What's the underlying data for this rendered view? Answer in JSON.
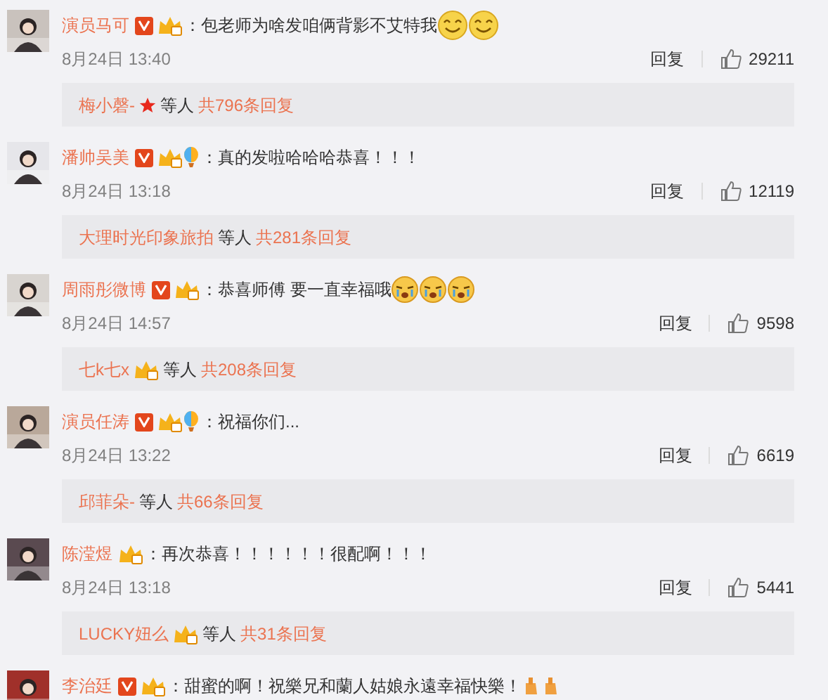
{
  "comments": [
    {
      "name": "演员马可",
      "verified": true,
      "badges": [
        {
          "kind": "vip"
        }
      ],
      "text": "：包老师为啥发咱俩背影不艾特我",
      "emojis": [
        {
          "kind": "smile"
        },
        {
          "kind": "smile"
        }
      ],
      "date": "8月24日 13:40",
      "reply": "回复",
      "likes": "29211",
      "preview": {
        "name": "梅小磬-",
        "badge": {
          "kind": "star"
        },
        "middle": "等人",
        "count": "共796条回复"
      }
    },
    {
      "name": "潘帅吴美",
      "verified": true,
      "badges": [
        {
          "kind": "vip"
        },
        {
          "kind": "balloon"
        }
      ],
      "text": "：真的发啦哈哈哈恭喜！！！",
      "date": "8月24日 13:18",
      "reply": "回复",
      "likes": "12119",
      "preview": {
        "name": "大理时光印象旅拍",
        "middle": "等人",
        "count": "共281条回复"
      }
    },
    {
      "name": "周雨彤微博",
      "verified": true,
      "badges": [
        {
          "kind": "vip"
        }
      ],
      "text": "：恭喜师傅 要一直幸福哦",
      "emojis": [
        {
          "kind": "cry"
        },
        {
          "kind": "cry"
        },
        {
          "kind": "cry"
        }
      ],
      "date": "8月24日 14:57",
      "reply": "回复",
      "likes": "9598",
      "preview": {
        "name": "七k七x",
        "badge": {
          "kind": "vip"
        },
        "middle": "等人",
        "count": "共208条回复"
      }
    },
    {
      "name": "演员任涛",
      "verified": true,
      "badges": [
        {
          "kind": "vip"
        },
        {
          "kind": "balloon"
        }
      ],
      "text": "：祝福你们...",
      "date": "8月24日 13:22",
      "reply": "回复",
      "likes": "6619",
      "preview": {
        "name": "邱菲朵-",
        "middle": "等人",
        "count": "共66条回复"
      }
    },
    {
      "name": "陈滢煜",
      "verified": false,
      "badges": [
        {
          "kind": "vip"
        }
      ],
      "text": "：再次恭喜！！！！！！很配啊！！！",
      "date": "8月24日 13:18",
      "reply": "回复",
      "likes": "5441",
      "preview": {
        "name": "LUCKY妞么",
        "badge": {
          "kind": "vip"
        },
        "middle": "等人",
        "count": "共31条回复"
      }
    },
    {
      "name": "李治廷",
      "verified": true,
      "badges": [
        {
          "kind": "vip"
        }
      ],
      "text": "：甜蜜的啊！祝樂兄和蘭人姑娘永遠幸福快樂！",
      "emojis": [
        {
          "kind": "hand"
        },
        {
          "kind": "hand"
        }
      ]
    }
  ]
}
